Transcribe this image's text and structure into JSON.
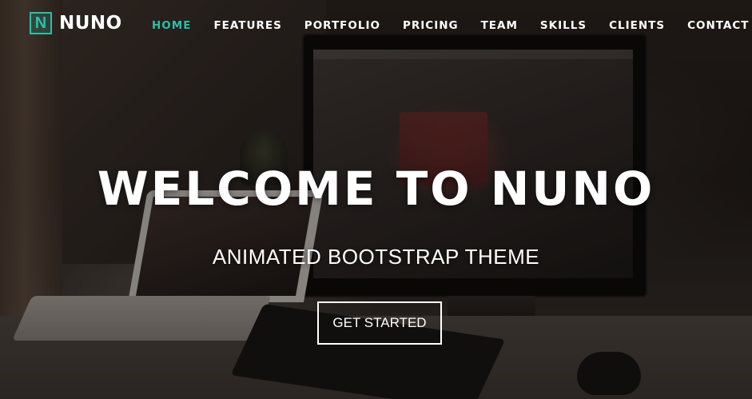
{
  "brand": {
    "logo_letter": "N",
    "name": "NUNO",
    "accent_color": "#2bbfa8"
  },
  "nav": {
    "items": [
      {
        "label": "HOME",
        "active": true
      },
      {
        "label": "FEATURES",
        "active": false
      },
      {
        "label": "PORTFOLIO",
        "active": false
      },
      {
        "label": "PRICING",
        "active": false
      },
      {
        "label": "TEAM",
        "active": false
      },
      {
        "label": "SKILLS",
        "active": false
      },
      {
        "label": "CLIENTS",
        "active": false
      },
      {
        "label": "CONTACT",
        "active": false
      }
    ]
  },
  "hero": {
    "title": "WELCOME TO NUNO",
    "subtitle": "ANIMATED BOOTSTRAP THEME",
    "cta_label": "GET STARTED",
    "background_image": "photo of a desk with a laptop, desktop monitor, keyboard and mouse"
  }
}
